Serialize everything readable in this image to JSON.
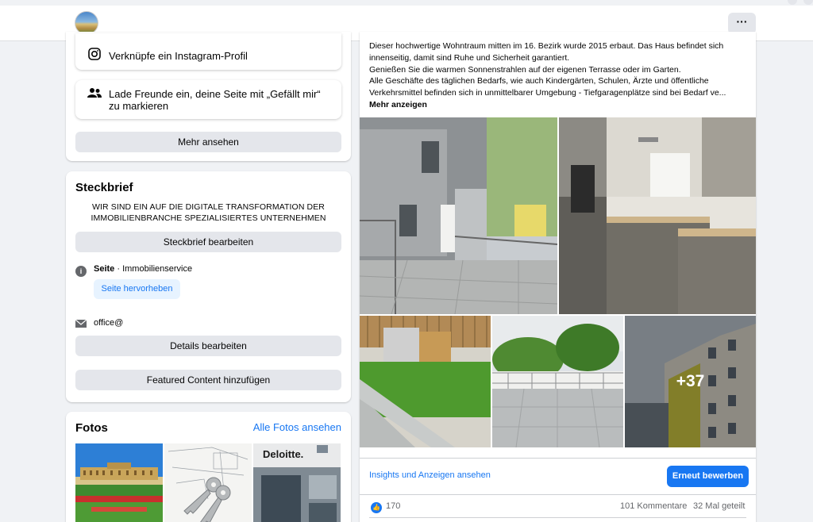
{
  "header": {
    "more_label": "···"
  },
  "actions": {
    "instagram_label": "Verknüpfe ein Instagram-Profil",
    "invite_label": "Lade Freunde ein, deine Seite mit „Gefällt mir“ zu markieren",
    "more_label": "Mehr ansehen"
  },
  "steckbrief": {
    "title": "Steckbrief",
    "description": "WIR SIND EIN AUF DIE DIGITALE TRANSFORMATION DER IMMOBILIENBRANCHE SPEZIALISIERTES UNTERNEHMEN",
    "edit_label": "Steckbrief bearbeiten",
    "page_label": "Seite",
    "category": " · Immobilienservice",
    "highlight_label": "Seite hervorheben",
    "email": "office@",
    "details_label": "Details bearbeiten",
    "featured_label": "Featured Content hinzufügen"
  },
  "fotos": {
    "title": "Fotos",
    "all_label": "Alle Fotos ansehen",
    "thumb3_text": "Deloitte."
  },
  "post": {
    "lines": [
      "Dieser hochwertige Wohntraum mitten im 16. Bezirk wurde 2015 erbaut. Das Haus befindet sich",
      "innenseitig, damit sind Ruhe und Sicherheit garantiert.",
      "Genießen Sie die warmen Sonnenstrahlen auf der eigenen Terrasse oder im Garten.",
      "Alle Geschäfte des täglichen Bedarfs, wie auch Kindergärten, Schulen, Ärzte und öffentliche",
      "Verkehrsmittel befinden sich in unmittelbarer Umgebung - Tiefgaragenplätze sind bei Bedarf ve..."
    ],
    "more_label": "Mehr anzeigen",
    "more_photos": "+37",
    "insights_label": "Insights und Anzeigen ansehen",
    "boost_label": "Erneut bewerben",
    "likes": "170",
    "comments": "101 Kommentare",
    "shares": "32 Mal geteilt"
  }
}
